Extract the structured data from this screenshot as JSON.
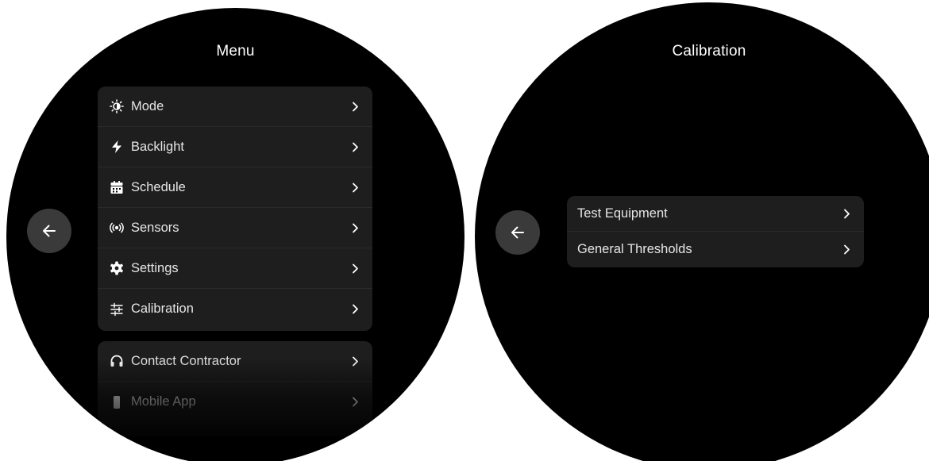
{
  "menu_screen": {
    "title": "Menu",
    "main_items": [
      {
        "label": "Mode",
        "icon": "brightness-half-icon"
      },
      {
        "label": "Backlight",
        "icon": "bolt-icon"
      },
      {
        "label": "Schedule",
        "icon": "calendar-icon"
      },
      {
        "label": "Sensors",
        "icon": "broadcast-icon"
      },
      {
        "label": "Settings",
        "icon": "gear-icon"
      },
      {
        "label": "Calibration",
        "icon": "sliders-icon"
      }
    ],
    "secondary_items": [
      {
        "label": "Contact Contractor",
        "icon": "headphones-icon"
      },
      {
        "label": "Mobile App",
        "icon": "phone-icon"
      }
    ]
  },
  "calibration_screen": {
    "title": "Calibration",
    "items": [
      {
        "label": "Test Equipment"
      },
      {
        "label": "General Thresholds"
      }
    ]
  },
  "colors": {
    "screen_background": "#000000",
    "card_background": "#1e1e1e",
    "back_button": "#3a3a3a",
    "text": "#e6e6e6"
  }
}
